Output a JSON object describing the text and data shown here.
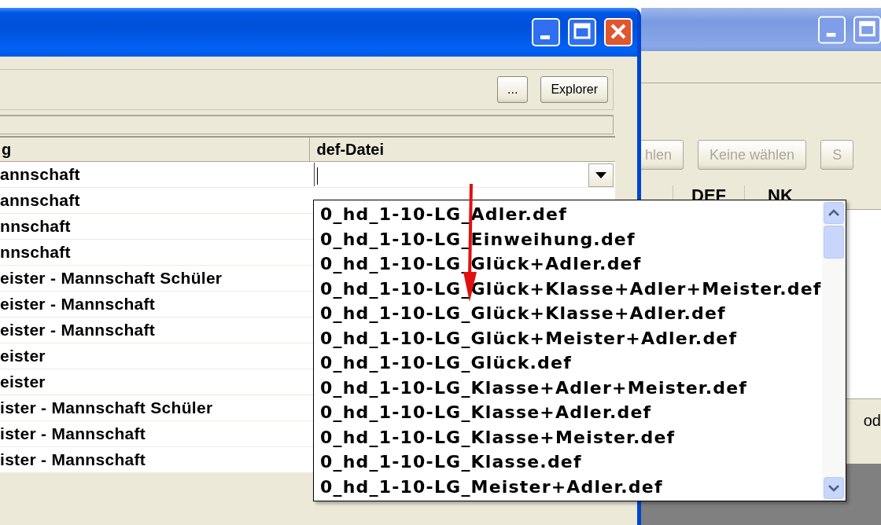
{
  "front_window": {
    "active": true,
    "toolbar_buttons": [
      "...",
      "Explorer"
    ],
    "table": {
      "columns": [
        "g",
        "def-Datei"
      ],
      "rows": [
        {
          "kind": "combo",
          "cell": "annschaft"
        },
        {
          "kind": "text",
          "cell": "annschaft"
        },
        {
          "kind": "text",
          "cell": "nnschaft"
        },
        {
          "kind": "text",
          "cell": "nnschaft"
        },
        {
          "kind": "text",
          "cell": "eister - Mannschaft Schüler"
        },
        {
          "kind": "text",
          "cell": "eister - Mannschaft"
        },
        {
          "kind": "text",
          "cell": "eister - Mannschaft"
        },
        {
          "kind": "text",
          "cell": "eister"
        },
        {
          "kind": "text",
          "cell": "eister"
        },
        {
          "kind": "text",
          "cell": "ister - Mannschaft Schüler"
        },
        {
          "kind": "text",
          "cell": "ister - Mannschaft"
        },
        {
          "kind": "text",
          "cell": "ister - Mannschaft"
        }
      ]
    }
  },
  "dropdown": {
    "items": [
      "0_hd_1-10-LG_Adler.def",
      "0_hd_1-10-LG_Einweihung.def",
      "0_hd_1-10-LG_Glück+Adler.def",
      "0_hd_1-10-LG_Glück+Klasse+Adler+Meister.def",
      "0_hd_1-10-LG_Glück+Klasse+Adler.def",
      "0_hd_1-10-LG_Glück+Meister+Adler.def",
      "0_hd_1-10-LG_Glück.def",
      "0_hd_1-10-LG_Klasse+Adler+Meister.def",
      "0_hd_1-10-LG_Klasse+Adler.def",
      "0_hd_1-10-LG_Klasse+Meister.def",
      "0_hd_1-10-LG_Klasse.def",
      "0_hd_1-10-LG_Meister+Adler.def"
    ]
  },
  "back_window": {
    "active": false,
    "buttons": [
      {
        "label": "hlen",
        "disabled": true
      },
      {
        "label": "Keine wählen",
        "disabled": true
      },
      {
        "label": "S",
        "disabled": true
      }
    ],
    "columns": [
      "DEF",
      "NK"
    ],
    "side_text": "od"
  }
}
